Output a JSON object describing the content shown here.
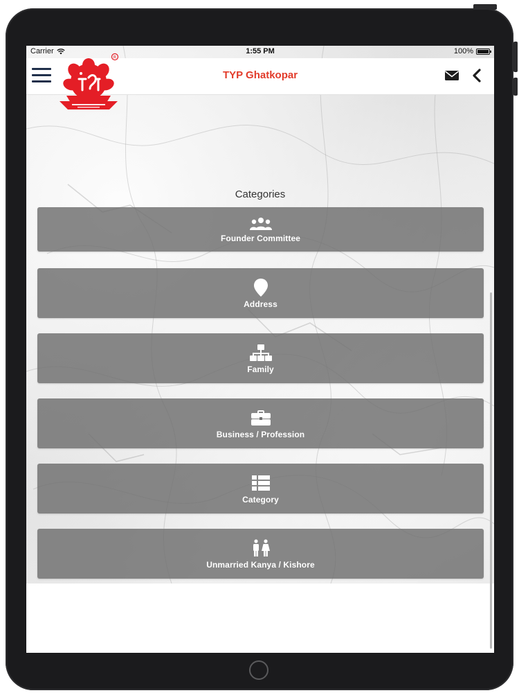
{
  "status_bar": {
    "carrier": "Carrier",
    "time": "1:55 PM",
    "battery": "100%"
  },
  "nav": {
    "title": "TYP Ghatkopar",
    "title_color": "#e23b2a",
    "menu_icon": "hamburger-menu-icon",
    "mail_icon": "envelope-icon",
    "back_icon": "chevron-left-icon"
  },
  "logo": {
    "brand_color": "#e41e26",
    "mark": "R"
  },
  "main": {
    "heading": "Categories",
    "items": [
      {
        "label": "Founder Committee",
        "icon": "users-group-icon"
      },
      {
        "label": "Address",
        "icon": "map-pin-icon"
      },
      {
        "label": "Family",
        "icon": "sitemap-icon"
      },
      {
        "label": "Business / Profession",
        "icon": "briefcase-icon"
      },
      {
        "label": "Category",
        "icon": "list-icon"
      },
      {
        "label": "Unmarried Kanya / Kishore",
        "icon": "male-female-icon"
      }
    ]
  }
}
